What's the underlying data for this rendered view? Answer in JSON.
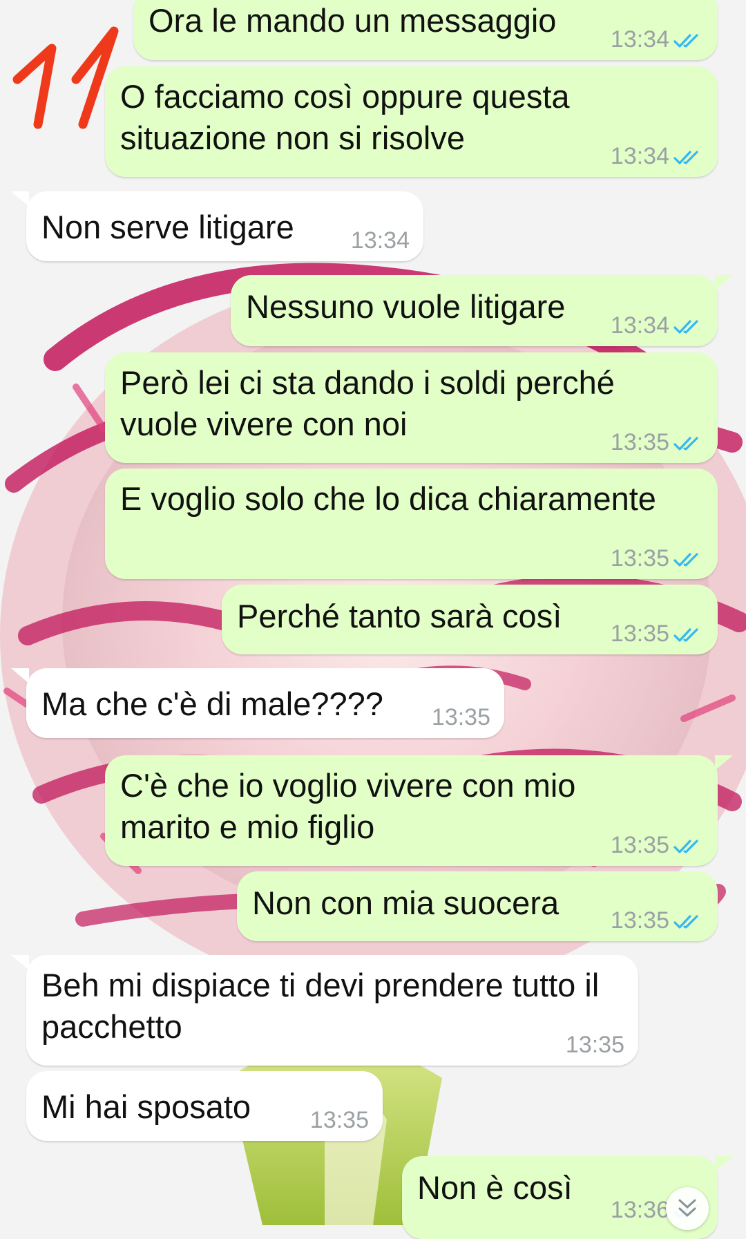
{
  "annotation": {
    "label": "11",
    "color": "#ee3a1b"
  },
  "colors": {
    "outgoing": "#e2ffc7",
    "incoming": "#ffffff",
    "read_ticks": "#34b7f1",
    "timestamp": "#9aa0a3"
  },
  "messages": [
    {
      "dir": "out",
      "text": "Ora le mando un messaggio",
      "time": "13:34",
      "status": "read"
    },
    {
      "dir": "out",
      "text": "O facciamo così oppure questa situazione non si risolve",
      "time": "13:34",
      "status": "read"
    },
    {
      "dir": "in",
      "text": "Non serve litigare",
      "time": "13:34"
    },
    {
      "dir": "out",
      "text": "Nessuno vuole litigare",
      "time": "13:34",
      "status": "read"
    },
    {
      "dir": "out",
      "text": "Però lei ci sta dando i soldi perché vuole vivere con noi",
      "time": "13:35",
      "status": "read"
    },
    {
      "dir": "out",
      "text": "E voglio solo che lo dica chiaramente",
      "time": "13:35",
      "status": "read"
    },
    {
      "dir": "out",
      "text": "Perché tanto sarà così",
      "time": "13:35",
      "status": "read"
    },
    {
      "dir": "in",
      "text": "Ma che c'è di male????",
      "time": "13:35"
    },
    {
      "dir": "out",
      "text": "C'è che io voglio vivere con mio marito e mio figlio",
      "time": "13:35",
      "status": "read"
    },
    {
      "dir": "out",
      "text": "Non con mia suocera",
      "time": "13:35",
      "status": "read"
    },
    {
      "dir": "in",
      "text": "Beh mi dispiace ti devi prendere tutto il pacchetto",
      "time": "13:35"
    },
    {
      "dir": "in",
      "text": "Mi hai sposato",
      "time": "13:35"
    },
    {
      "dir": "out",
      "text": "Non è così",
      "time": "13:36",
      "status": "read"
    }
  ],
  "icons": {
    "read_receipt": "double-check-icon",
    "scroll": "chevron-double-down-icon"
  }
}
